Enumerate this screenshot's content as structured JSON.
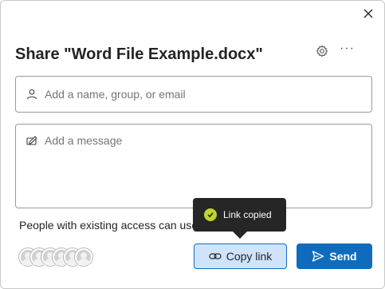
{
  "dialog": {
    "title": "Share \"Word File Example.docx\"",
    "close_icon": "close-icon",
    "settings_icon": "gear-icon",
    "more_icon": "more-options-icon",
    "more_glyph": "···"
  },
  "recipients": {
    "placeholder": "Add a name, group, or email",
    "icon": "person-icon"
  },
  "message": {
    "placeholder": "Add a message",
    "icon": "pencil-message-icon"
  },
  "access_text": "People with existing access can use",
  "toast": {
    "text": "Link copied",
    "icon": "checkmark-circle-icon",
    "color": "#bfd630"
  },
  "avatars_count": 5,
  "buttons": {
    "copy_link": "Copy link",
    "send": "Send"
  },
  "colors": {
    "accent": "#0f6cbd",
    "copy_bg": "#cfe4fa",
    "tooltip_bg": "#262626"
  }
}
